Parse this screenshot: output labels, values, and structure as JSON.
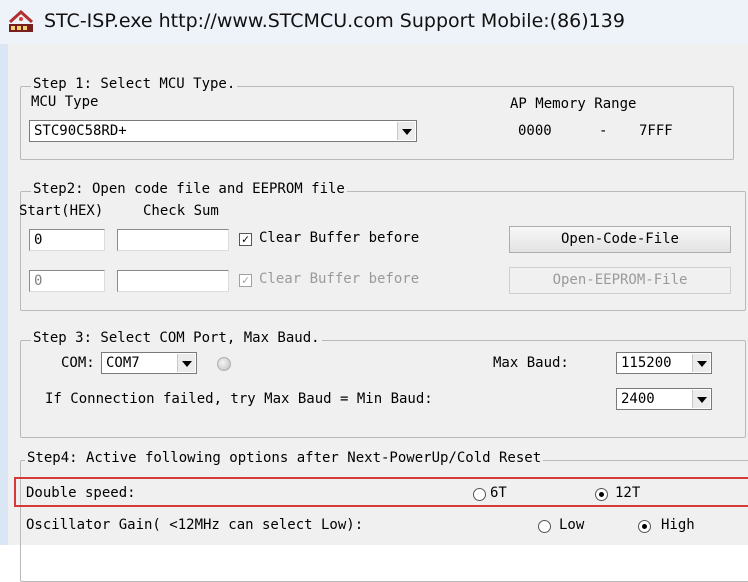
{
  "window": {
    "title": "STC-ISP.exe  http://www.STCMCU.com  Support Mobile:(86)139"
  },
  "step1": {
    "legend": "Step 1: Select MCU Type.",
    "mcu_type_label": "MCU Type",
    "mcu_type_value": "STC90C58RD+",
    "ap_memory_label": "AP Memory Range",
    "ap_start": "0000",
    "ap_dash": "-",
    "ap_end": "7FFF"
  },
  "step2": {
    "legend": "Step2: Open code file and EEPROM file",
    "start_label": "Start(HEX)",
    "checksum_label": "Check Sum",
    "code_start_value": "0",
    "code_checksum_value": "",
    "code_clear_label": "Clear Buffer before",
    "code_clear_checked": true,
    "open_code_label": "Open-Code-File",
    "eeprom_start_value": "0",
    "eeprom_checksum_value": "",
    "eeprom_clear_label": "Clear Buffer before",
    "eeprom_clear_checked": true,
    "open_eeprom_label": "Open-EEPROM-File"
  },
  "step3": {
    "legend": "Step 3: Select COM Port, Max Baud.",
    "com_label": "COM:",
    "com_value": "COM7",
    "max_baud_label": "Max Baud:",
    "max_baud_value": "115200",
    "min_baud_label": "If Connection failed, try Max Baud = Min Baud:",
    "min_baud_value": "2400"
  },
  "step4": {
    "legend": "Step4: Active following options after Next-PowerUp/Cold Reset",
    "double_speed_label": "Double speed:",
    "opt_6t": "6T",
    "opt_12t": "12T",
    "selected_speed": "12T",
    "osc_gain_label": "Oscillator Gain( <12MHz can select Low):",
    "opt_low": "Low",
    "opt_high": "High",
    "selected_gain": "High"
  },
  "colors": {
    "highlight": "#d43a3a",
    "frame_border": "#dbe6f4"
  }
}
